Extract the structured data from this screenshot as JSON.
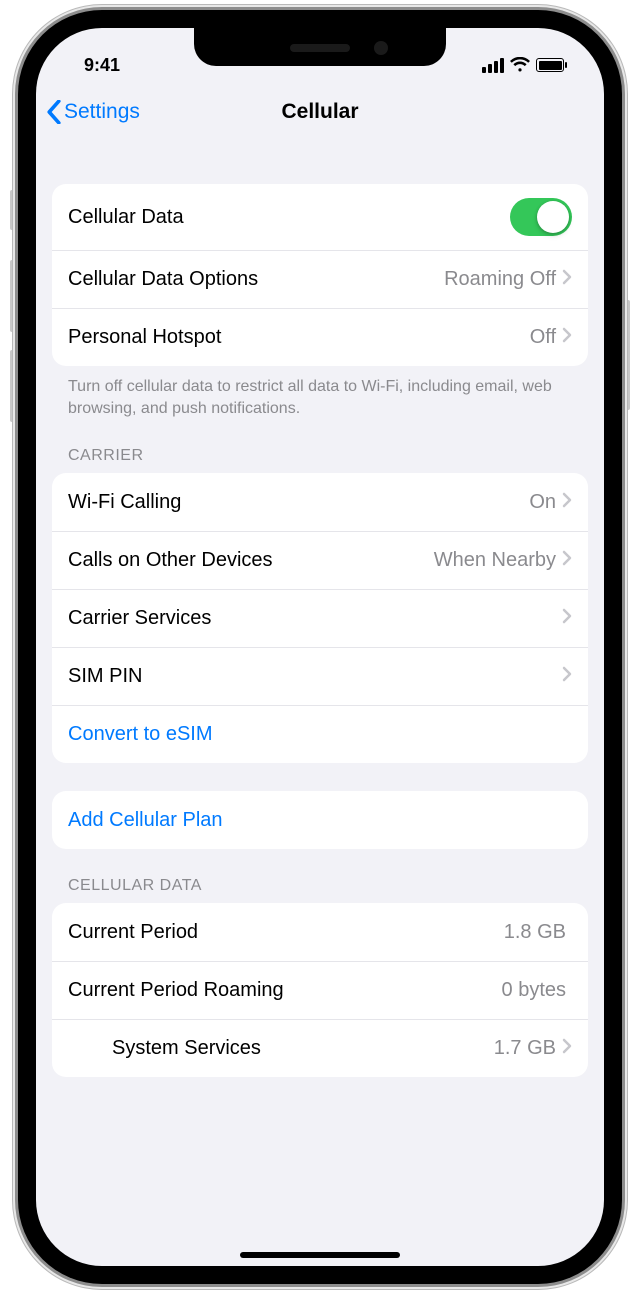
{
  "status": {
    "time": "9:41"
  },
  "nav": {
    "back_label": "Settings",
    "title": "Cellular"
  },
  "section1": {
    "cellular_data": {
      "label": "Cellular Data",
      "on": true
    },
    "cellular_data_options": {
      "label": "Cellular Data Options",
      "value": "Roaming Off"
    },
    "personal_hotspot": {
      "label": "Personal Hotspot",
      "value": "Off"
    },
    "footer": "Turn off cellular data to restrict all data to Wi-Fi, including email, web browsing, and push notifications."
  },
  "carrier": {
    "header": "Carrier",
    "wifi_calling": {
      "label": "Wi-Fi Calling",
      "value": "On"
    },
    "calls_other": {
      "label": "Calls on Other Devices",
      "value": "When Nearby"
    },
    "carrier_services": {
      "label": "Carrier Services"
    },
    "sim_pin": {
      "label": "SIM PIN"
    },
    "convert_esim": {
      "label": "Convert to eSIM"
    }
  },
  "add_plan": {
    "label": "Add Cellular Plan"
  },
  "cellular_data_usage": {
    "header": "Cellular Data",
    "current_period": {
      "label": "Current Period",
      "value": "1.8 GB"
    },
    "current_period_roaming": {
      "label": "Current Period Roaming",
      "value": "0 bytes"
    },
    "system_services": {
      "label": "System Services",
      "value": "1.7 GB"
    }
  }
}
